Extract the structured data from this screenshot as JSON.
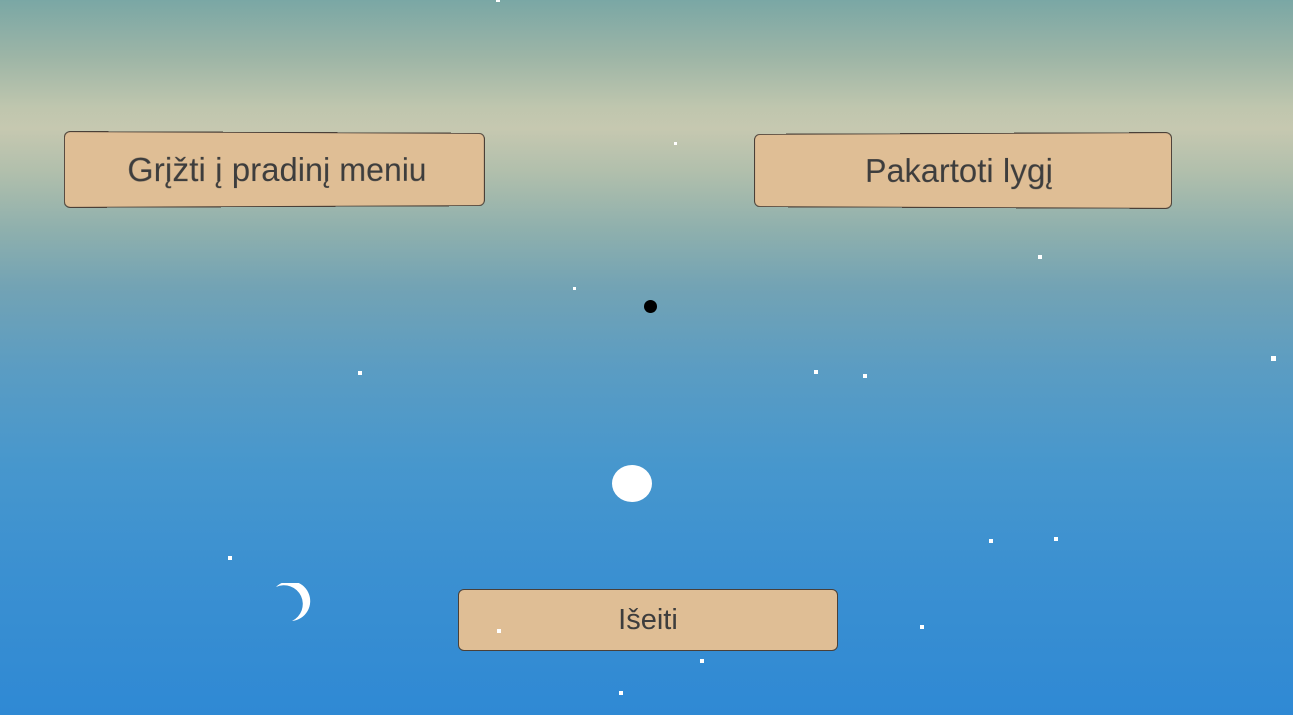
{
  "buttons": {
    "main_menu_label": "Grįžti į pradinį meniu",
    "retry_label": "Pakartoti lygį",
    "exit_label": "Išeiti"
  },
  "colors": {
    "button_fill": "#dfbe95",
    "button_border": "#4a4038",
    "button_text": "#3d3d3d",
    "sky_top": "#7aa7a5",
    "sky_horizon": "#c6c8b0",
    "sky_bottom": "#2f89d4"
  },
  "icons": {
    "player_marker": "black-dot-icon",
    "full_moon": "full-moon-icon",
    "crescent_moon": "crescent-moon-icon",
    "stars": "star-icon"
  }
}
